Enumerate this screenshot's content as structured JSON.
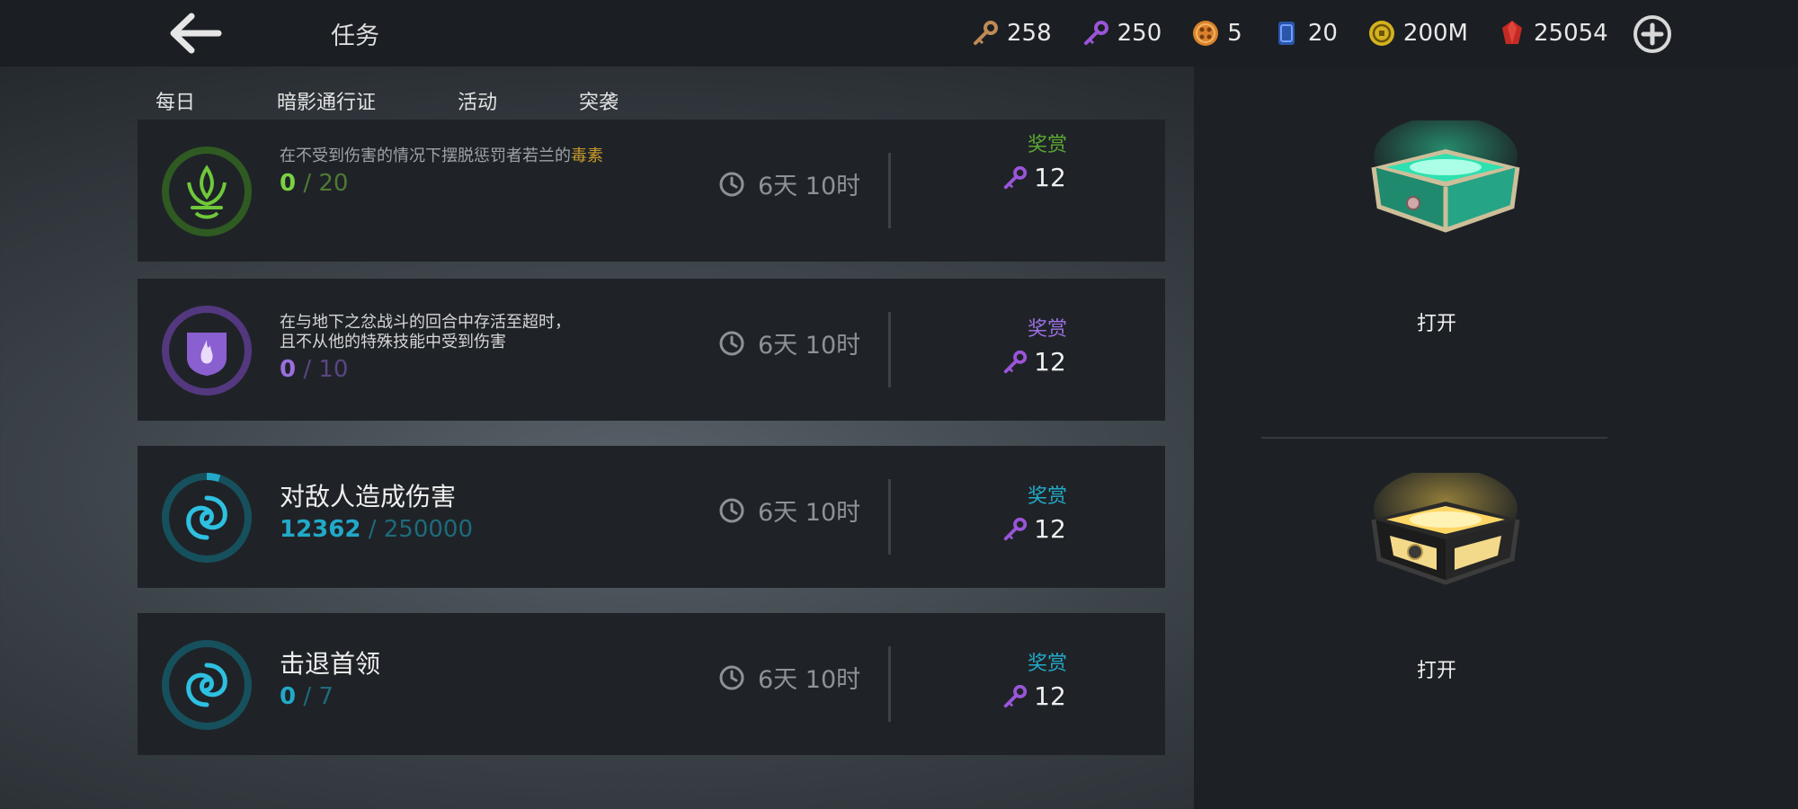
{
  "header": {
    "title": "任务",
    "currencies": [
      {
        "icon": "bronze-key-icon",
        "value": "258"
      },
      {
        "icon": "purple-key-icon",
        "value": "250"
      },
      {
        "icon": "orange-token-icon",
        "value": "5"
      },
      {
        "icon": "blue-card-icon",
        "value": "20"
      },
      {
        "icon": "gold-coin-icon",
        "value": "200M"
      },
      {
        "icon": "red-gem-icon",
        "value": "25054"
      }
    ]
  },
  "tabs": [
    {
      "label": "每日",
      "active": false
    },
    {
      "label": "暗影通行证",
      "active": false
    },
    {
      "label": "活动",
      "active": false
    },
    {
      "label": "突袭",
      "active": true
    }
  ],
  "quests": [
    {
      "desc_before": "在不受到伤害的情况下摆脱惩罚者若兰的",
      "desc_highlight": "毒素",
      "progress_current": "0",
      "progress_total": "20",
      "timer": "6天 10时",
      "reward_label": "奖赏",
      "reward_value": "12",
      "icon": "lotus-icon",
      "color": "#6fc83b"
    },
    {
      "desc_line1": "在与地下之忿战斗的回合中存活至超时，",
      "desc_line2": "且不从他的特殊技能中受到伤害",
      "progress_current": "0",
      "progress_total": "10",
      "timer": "6天 10时",
      "reward_label": "奖赏",
      "reward_value": "12",
      "icon": "shield-fire-icon",
      "color": "#8a5fd0"
    },
    {
      "title": "对敌人造成伤害",
      "progress_current": "12362",
      "progress_total": "250000",
      "progress_fraction": 0.049,
      "timer": "6天 10时",
      "reward_label": "奖赏",
      "reward_value": "12",
      "icon": "swirl-icon",
      "color": "#22a9c8"
    },
    {
      "title": "击退首领",
      "progress_current": "0",
      "progress_total": "7",
      "timer": "6天 10时",
      "reward_label": "奖赏",
      "reward_value": "12",
      "icon": "swirl-icon",
      "color": "#22a9c8"
    }
  ],
  "chests": [
    {
      "button": "打开",
      "glow": "#2fe0a6"
    },
    {
      "button": "打开",
      "glow": "#f0c84a"
    }
  ]
}
